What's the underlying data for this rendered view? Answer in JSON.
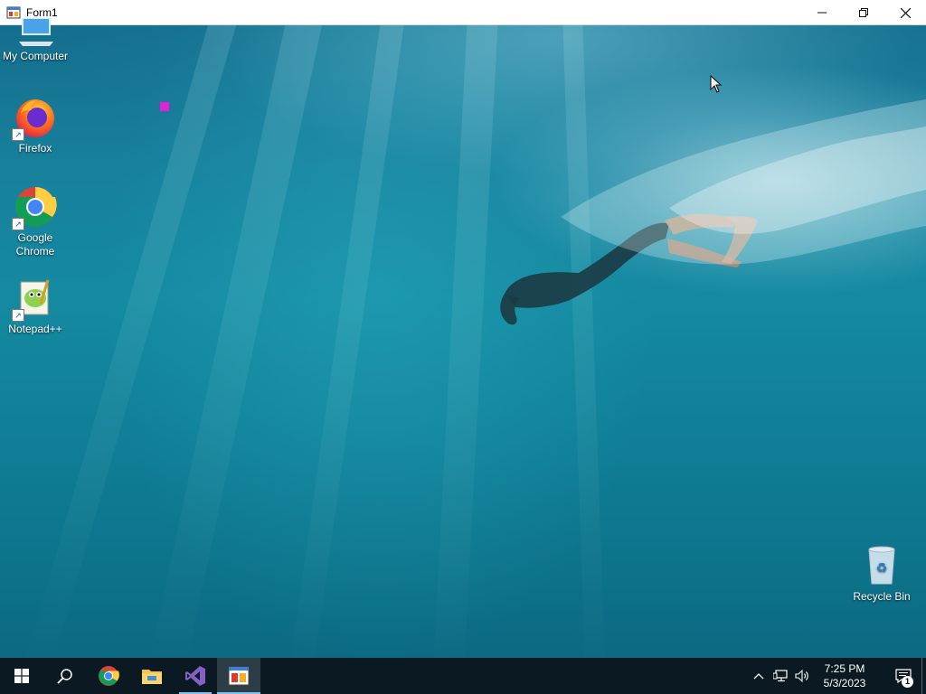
{
  "window": {
    "title": "Form1",
    "controls": {
      "minimize": "minimize-icon",
      "restore": "restore-icon",
      "close": "close-icon"
    }
  },
  "desktop_icons": [
    {
      "label": "My Computer",
      "icon": "computer-icon"
    },
    {
      "label": "Firefox",
      "icon": "firefox-icon"
    },
    {
      "label": "Google Chrome",
      "icon": "chrome-icon"
    },
    {
      "label": "Notepad++",
      "icon": "notepadpp-icon"
    },
    {
      "label": "Recycle Bin",
      "icon": "recycle-bin-icon"
    }
  ],
  "taskbar": {
    "pinned": [
      "start-icon",
      "search-icon",
      "chrome-icon",
      "file-explorer-icon",
      "visual-studio-icon",
      "form-app-icon"
    ],
    "tray": {
      "time": "7:25 PM",
      "date": "5/3/2023",
      "notification_count": "1"
    }
  },
  "colors": {
    "taskbar": "#0b1a22",
    "active_indicator": "#7cc3ef",
    "marker": "#e81fd8"
  }
}
